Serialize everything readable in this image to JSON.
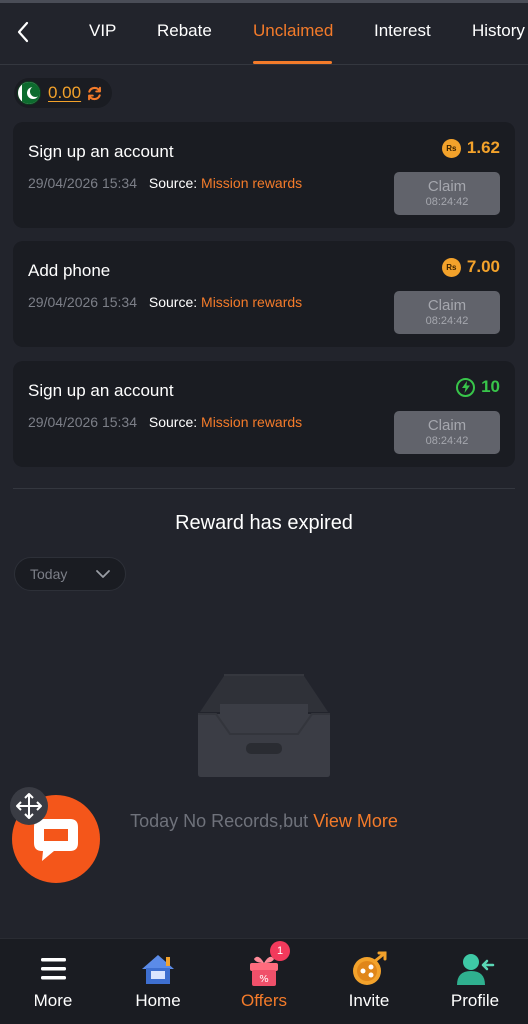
{
  "tabs": [
    {
      "label": "VIP"
    },
    {
      "label": "Rebate"
    },
    {
      "label": "Unclaimed",
      "active": true
    },
    {
      "label": "Interest"
    },
    {
      "label": "History"
    }
  ],
  "balance": {
    "value": "0.00",
    "flag_icon": "pakistan-flag-icon"
  },
  "missions": [
    {
      "title": "Sign up an account",
      "date": "29/04/2026 15:34",
      "source_label": "Source:",
      "source": "Mission rewards",
      "reward": "1.62",
      "reward_icon": "rupee-coin-icon",
      "reward_color": "#f3a22b",
      "claim_label": "Claim",
      "claim_timer": "08:24:42"
    },
    {
      "title": "Add phone",
      "date": "29/04/2026 15:34",
      "source_label": "Source:",
      "source": "Mission rewards",
      "reward": "7.00",
      "reward_icon": "rupee-coin-icon",
      "reward_color": "#f3a22b",
      "claim_label": "Claim",
      "claim_timer": "08:24:42"
    },
    {
      "title": "Sign up an account",
      "date": "29/04/2026 15:34",
      "source_label": "Source:",
      "source": "Mission rewards",
      "reward": "10",
      "reward_icon": "lightning-icon",
      "reward_color": "#38c54a",
      "claim_label": "Claim",
      "claim_timer": "08:24:42"
    }
  ],
  "coin_symbol": "Rs",
  "expired": {
    "title": "Reward has expired",
    "filter": {
      "selected": "Today"
    },
    "empty_text": "Today No Records,but ",
    "empty_link": "View More"
  },
  "bottom_nav": [
    {
      "label": "More",
      "icon": "menu-icon"
    },
    {
      "label": "Home",
      "icon": "home-icon"
    },
    {
      "label": "Offers",
      "icon": "gift-icon",
      "active": true,
      "badge": "1"
    },
    {
      "label": "Invite",
      "icon": "invite-icon"
    },
    {
      "label": "Profile",
      "icon": "profile-icon"
    }
  ],
  "colors": {
    "accent": "#f47b2a",
    "background": "#22242c",
    "card": "#1a1c22",
    "gold": "#f3a22b",
    "green": "#38c54a",
    "chat": "#f4561a"
  }
}
